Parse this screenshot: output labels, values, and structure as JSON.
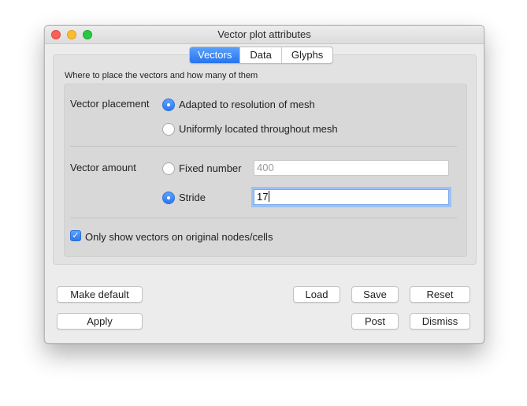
{
  "window": {
    "title": "Vector plot attributes",
    "controls": [
      "close",
      "minimize",
      "zoom"
    ]
  },
  "tabs": [
    {
      "label": "Vectors",
      "active": true
    },
    {
      "label": "Data",
      "active": false
    },
    {
      "label": "Glyphs",
      "active": false
    }
  ],
  "description": "Where to place the vectors and how many of them",
  "placement": {
    "label": "Vector placement",
    "options": [
      {
        "label": "Adapted to resolution of mesh",
        "selected": true
      },
      {
        "label": "Uniformly located throughout mesh",
        "selected": false
      }
    ]
  },
  "amount": {
    "label": "Vector amount",
    "fixed": {
      "label": "Fixed number",
      "selected": false,
      "value": "400",
      "enabled": false
    },
    "stride": {
      "label": "Stride",
      "selected": true,
      "value": "17",
      "enabled": true
    }
  },
  "original_only": {
    "label": "Only show vectors on original nodes/cells",
    "checked": true
  },
  "buttons": {
    "make_default": "Make default",
    "apply": "Apply",
    "load": "Load",
    "save": "Save",
    "reset": "Reset",
    "post": "Post",
    "dismiss": "Dismiss"
  },
  "colors": {
    "accent": "#2c78f0",
    "close": "#fc5f57",
    "minimize": "#fdbc2e",
    "zoom": "#28c840"
  }
}
